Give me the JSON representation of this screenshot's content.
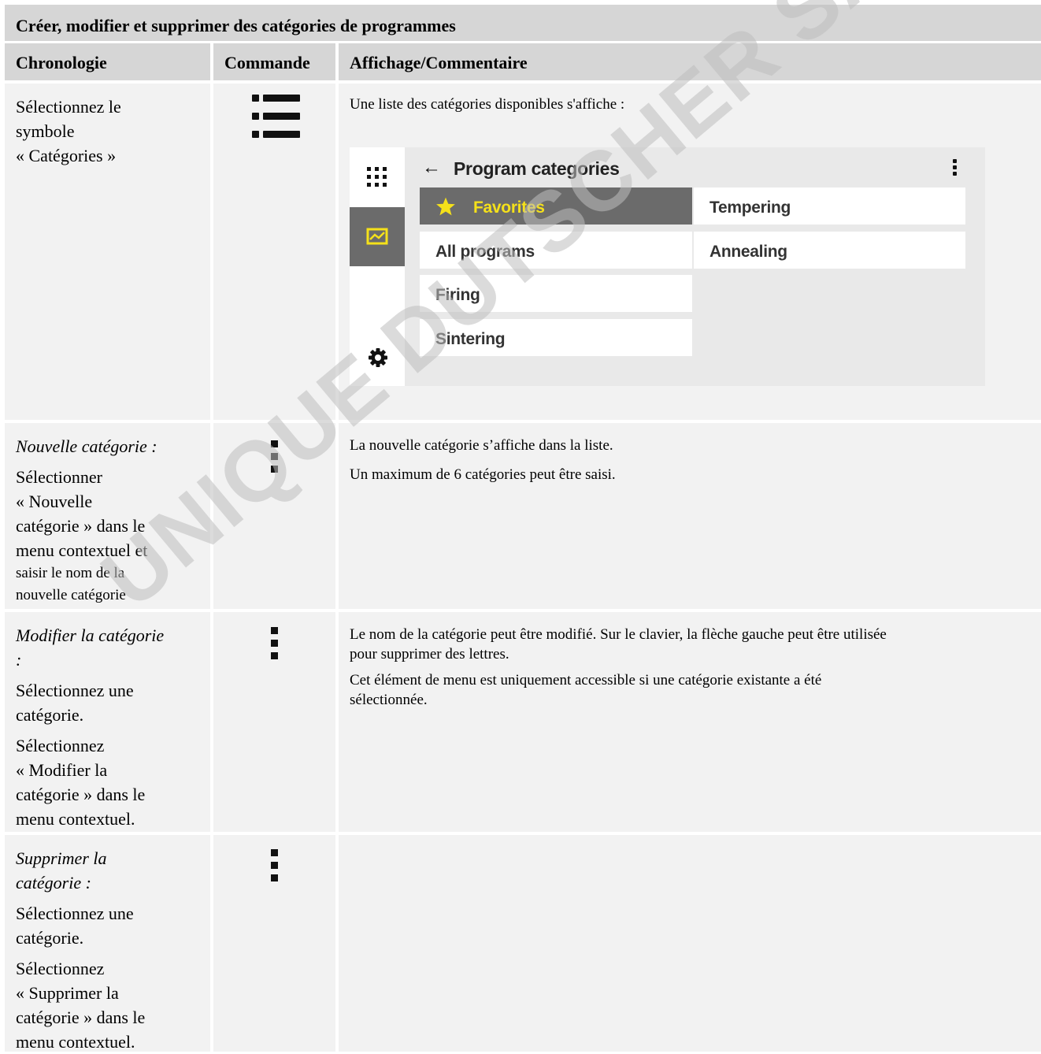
{
  "table": {
    "title": "Créer, modifier et supprimer des catégories de programmes",
    "headers": [
      "Chronologie",
      "Commande",
      "Affichage/Commentaire"
    ],
    "row1": {
      "step_lines": [
        "Sélectionnez le",
        "symbole",
        "« Catégories »"
      ],
      "command_icon": "list-icon",
      "comment": "Une liste des catégories disponibles s'affiche :"
    },
    "row2": {
      "step_title": "Nouvelle catégorie :",
      "step_lines": [
        "Sélectionner",
        "« Nouvelle",
        "catégorie » dans le",
        "menu contextuel et"
      ],
      "step_small_lines": [
        "saisir le nom de la",
        "nouvelle catégorie"
      ],
      "command_icon": "kebab-menu-icon",
      "comment": [
        "La nouvelle catégorie s’affiche dans la liste.",
        "Un maximum de 6 catégories peut être saisi."
      ]
    },
    "row3": {
      "step_title_lines": [
        "Modifier la catégorie",
        ":"
      ],
      "step_block1": [
        "Sélectionnez une",
        "catégorie."
      ],
      "step_block2": [
        "Sélectionnez",
        "« Modifier la",
        "catégorie » dans le",
        "menu contextuel."
      ],
      "command_icon": "kebab-menu-icon",
      "comment": [
        "Le nom de la catégorie peut être modifié. Sur le clavier, la flèche gauche peut être utilisée",
        "pour supprimer des lettres.",
        "Cet élément de menu est uniquement accessible si une catégorie existante a été",
        "sélectionnée."
      ]
    },
    "row4": {
      "step_title_lines": [
        "Supprimer la",
        "catégorie :"
      ],
      "step_block1": [
        "Sélectionnez une",
        "catégorie."
      ],
      "step_block2": [
        "Sélectionnez",
        "« Supprimer la",
        "catégorie » dans le",
        "menu contextuel."
      ],
      "command_icon": "kebab-menu-icon"
    }
  },
  "device": {
    "title": "Program categories",
    "back_icon": "arrow-left-icon",
    "menu_icon": "kebab-menu-icon",
    "sidebar": [
      "apps-grid-icon",
      "chart-icon",
      "gear-icon"
    ],
    "categories_left": [
      "Favorites",
      "All programs",
      "Firing",
      "Sintering"
    ],
    "categories_right": [
      "Tempering",
      "Annealing"
    ],
    "selected": "Favorites",
    "colors": {
      "selected_bg": "#6b6b6b",
      "selected_text": "#f5e11a",
      "background": "#e9e9e9"
    }
  },
  "watermark": "UNIQUE DUTSCHER SAS"
}
